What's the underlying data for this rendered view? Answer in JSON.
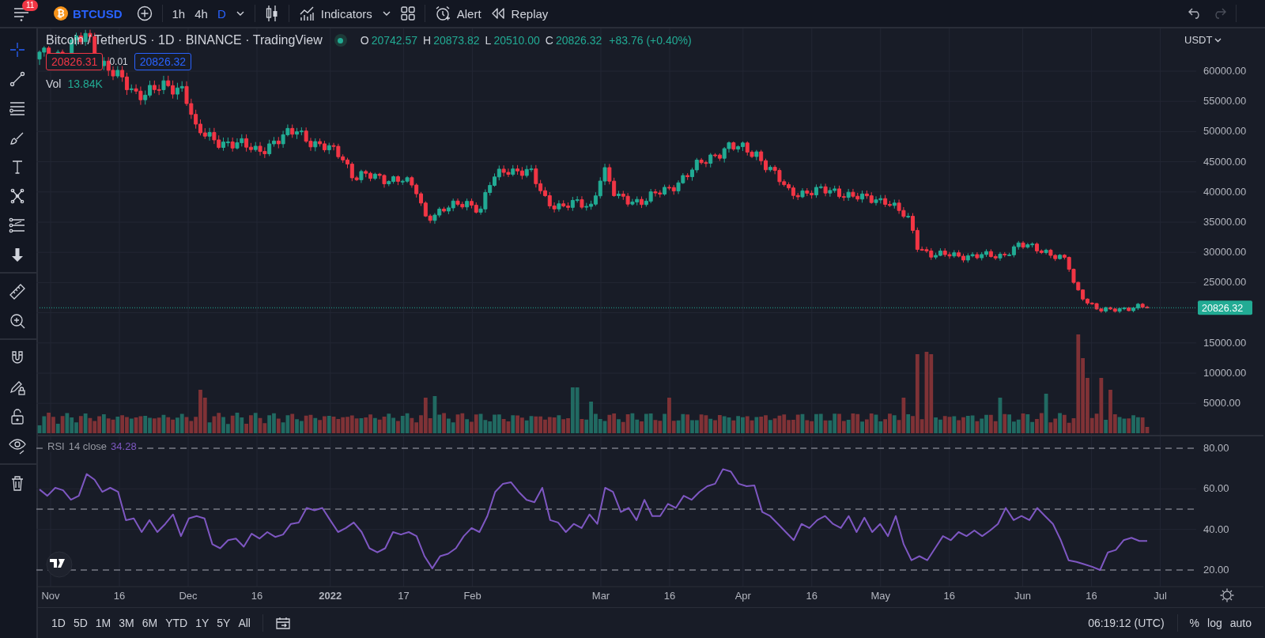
{
  "top_bar": {
    "notification_count": "11",
    "coin_symbol": "₿",
    "symbol": "BTCUSD",
    "intervals": [
      {
        "label": "1h",
        "selected": false
      },
      {
        "label": "4h",
        "selected": false
      },
      {
        "label": "D",
        "selected": true
      }
    ],
    "indicators": "Indicators",
    "alert": "Alert",
    "replay": "Replay",
    "redo_disabled": true
  },
  "toolbar": {
    "groups": [
      {
        "tools": [
          {
            "kind": "crosshair",
            "selected": true
          },
          {
            "kind": "trend-line",
            "selected": false
          },
          {
            "kind": "fib",
            "selected": false
          },
          {
            "kind": "brush",
            "selected": false
          },
          {
            "kind": "text",
            "selected": false
          },
          {
            "kind": "pattern",
            "selected": false
          },
          {
            "kind": "prediction",
            "selected": false
          },
          {
            "kind": "arrow-down",
            "selected": false
          }
        ]
      },
      {
        "tools": [
          {
            "kind": "ruler",
            "selected": false
          },
          {
            "kind": "zoom",
            "selected": false
          }
        ]
      },
      {
        "tools": [
          {
            "kind": "magnet",
            "selected": false
          },
          {
            "kind": "draw-lock",
            "selected": false
          },
          {
            "kind": "lock",
            "selected": false
          },
          {
            "kind": "eye",
            "selected": false
          }
        ]
      },
      {
        "tools": [
          {
            "kind": "trash",
            "selected": false
          }
        ]
      }
    ]
  },
  "legend": {
    "title": "Bitcoin / TetherUS · 1D · BINANCE · TradingView",
    "ohlc": [
      {
        "label": "O",
        "value": "20742.57"
      },
      {
        "label": "H",
        "value": "20873.82"
      },
      {
        "label": "L",
        "value": "20510.00"
      },
      {
        "label": "C",
        "value": "20826.32"
      }
    ],
    "change": "+83.76 (+0.40%)",
    "sell_price": "20826.31",
    "spread": "0.01",
    "buy_price": "20826.32",
    "volume_label": "Vol",
    "volume_value": "13.84K"
  },
  "price_axis": {
    "currency": "USDT",
    "ticks": [
      "60000.00",
      "55000.00",
      "50000.00",
      "45000.00",
      "40000.00",
      "35000.00",
      "30000.00",
      "25000.00"
    ],
    "lower_ticks": [
      "15000.00",
      "10000.00",
      "5000.00"
    ],
    "last_price": "20826.32"
  },
  "rsi": {
    "label": "14 close",
    "value": "34.28",
    "chart_data": {
      "type": "line",
      "ylim": [
        20,
        80
      ],
      "yticks": [
        {
          "value": 20,
          "label": "20.00"
        },
        {
          "value": 40,
          "label": "40.00"
        },
        {
          "value": 60,
          "label": "60.00"
        },
        {
          "value": 80,
          "label": "80.00"
        }
      ],
      "series": [
        {
          "name": "RSI",
          "color": "#7e57c2",
          "values": [
            59.7,
            56.6,
            60.5,
            59.3,
            54.6,
            56.6,
            67.3,
            64.5,
            58.5,
            60.5,
            58.5,
            44.6,
            45.4,
            38.7,
            44.6,
            38.7,
            42.7,
            47.4,
            36.7,
            45.4,
            46.6,
            45.4,
            32.7,
            30.7,
            34.7,
            35.5,
            31.5,
            37.9,
            35.5,
            38.7,
            36.3,
            37.5,
            42.7,
            43.4,
            50.6,
            49.4,
            50.6,
            44.6,
            38.7,
            40.7,
            43.4,
            38.7,
            30.7,
            28.7,
            30.7,
            38.7,
            37.5,
            38.7,
            36.7,
            26.8,
            20.8,
            26.8,
            28.0,
            30.7,
            36.7,
            40.7,
            38.7,
            46.6,
            58.5,
            62.5,
            63.3,
            58.5,
            54.6,
            53.4,
            60.5,
            44.6,
            43.4,
            38.7,
            42.7,
            40.7,
            47.4,
            42.7,
            60.5,
            58.5,
            48.6,
            50.6,
            44.6,
            54.6,
            46.6,
            46.6,
            52.6,
            50.6,
            56.6,
            54.6,
            58.5,
            61.3,
            62.5,
            69.7,
            68.5,
            62.5,
            61.3,
            61.7,
            48.6,
            46.6,
            42.7,
            38.7,
            34.7,
            42.7,
            40.7,
            44.6,
            46.6,
            42.7,
            40.7,
            46.6,
            38.7,
            45.8,
            38.7,
            42.7,
            36.7,
            46.6,
            32.7,
            24.8,
            26.8,
            24.8,
            30.7,
            36.7,
            34.7,
            38.7,
            36.7,
            39.5,
            36.7,
            39.5,
            42.7,
            50.6,
            44.6,
            46.6,
            44.6,
            50.6,
            46.6,
            42.7,
            34.7,
            24.8,
            24.0,
            22.8,
            21.6,
            20.0,
            28.7,
            29.9,
            34.7,
            35.9,
            34.3,
            34.3
          ]
        }
      ]
    }
  },
  "time_axis": {
    "labels": [
      {
        "label": "Nov",
        "kind": "month"
      },
      {
        "label": "16",
        "kind": "day"
      },
      {
        "label": "Dec",
        "kind": "month"
      },
      {
        "label": "16",
        "kind": "day"
      },
      {
        "label": "2022",
        "kind": "year"
      },
      {
        "label": "17",
        "kind": "day"
      },
      {
        "label": "Feb",
        "kind": "month"
      },
      {
        "label": "Mar",
        "kind": "month"
      },
      {
        "label": "16",
        "kind": "day"
      },
      {
        "label": "Apr",
        "kind": "month"
      },
      {
        "label": "16",
        "kind": "day"
      },
      {
        "label": "May",
        "kind": "month"
      },
      {
        "label": "16",
        "kind": "day"
      },
      {
        "label": "Jun",
        "kind": "month"
      },
      {
        "label": "16",
        "kind": "day"
      },
      {
        "label": "Jul",
        "kind": "month"
      }
    ]
  },
  "bottom_bar": {
    "ranges": [
      "1D",
      "5D",
      "1M",
      "3M",
      "6M",
      "YTD",
      "1Y",
      "5Y",
      "All"
    ],
    "clock": "06:19:12 (UTC)",
    "scale_options": [
      "%",
      "log",
      "auto"
    ]
  }
}
